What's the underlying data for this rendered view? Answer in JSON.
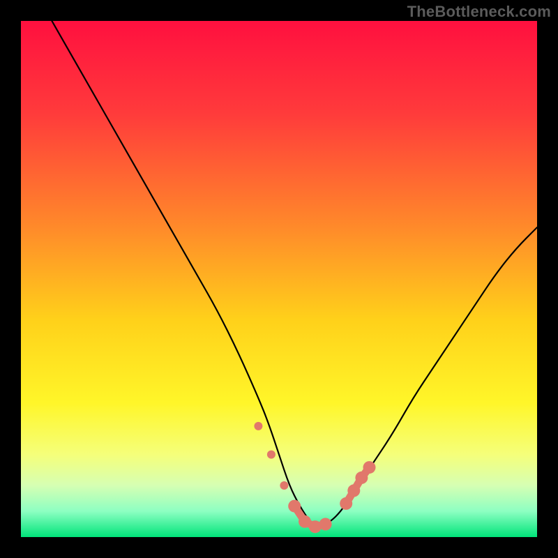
{
  "watermark": "TheBottleneck.com",
  "chart_data": {
    "type": "line",
    "title": "",
    "xlabel": "",
    "ylabel": "",
    "xlim": [
      0,
      100
    ],
    "ylim": [
      0,
      100
    ],
    "grid": false,
    "legend": false,
    "gradient_stops": [
      {
        "offset": 0.0,
        "color": "#ff103f"
      },
      {
        "offset": 0.18,
        "color": "#ff3b3b"
      },
      {
        "offset": 0.4,
        "color": "#ff8a2a"
      },
      {
        "offset": 0.58,
        "color": "#ffd11a"
      },
      {
        "offset": 0.74,
        "color": "#fff629"
      },
      {
        "offset": 0.84,
        "color": "#f5ff7a"
      },
      {
        "offset": 0.9,
        "color": "#d6ffb3"
      },
      {
        "offset": 0.95,
        "color": "#8dffc2"
      },
      {
        "offset": 1.0,
        "color": "#00e47a"
      }
    ],
    "series": [
      {
        "name": "bottleneck-curve",
        "x": [
          6,
          10,
          14,
          18,
          22,
          26,
          30,
          34,
          38,
          42,
          46,
          48,
          50,
          52,
          54,
          56,
          57,
          58,
          60,
          62,
          64,
          68,
          72,
          76,
          80,
          84,
          88,
          92,
          96,
          100
        ],
        "y": [
          100,
          93,
          86,
          79,
          72,
          65,
          58,
          51,
          44,
          36,
          27,
          22,
          16,
          10,
          6,
          3,
          2,
          2,
          3,
          5,
          8,
          14,
          20,
          27,
          33,
          39,
          45,
          51,
          56,
          60
        ]
      }
    ],
    "markers": [
      {
        "x": 46.0,
        "y": 21.5
      },
      {
        "x": 48.5,
        "y": 16.0
      },
      {
        "x": 51.0,
        "y": 10.0
      },
      {
        "x": 53.0,
        "y": 6.0
      },
      {
        "x": 55.0,
        "y": 3.0
      },
      {
        "x": 57.0,
        "y": 2.0
      },
      {
        "x": 59.0,
        "y": 2.5
      },
      {
        "x": 63.0,
        "y": 6.5
      },
      {
        "x": 64.5,
        "y": 9.0
      },
      {
        "x": 66.0,
        "y": 11.5
      },
      {
        "x": 67.5,
        "y": 13.5
      }
    ],
    "marker_color": "#e1786b",
    "marker_radius_small": 6,
    "marker_radius_large": 9
  }
}
